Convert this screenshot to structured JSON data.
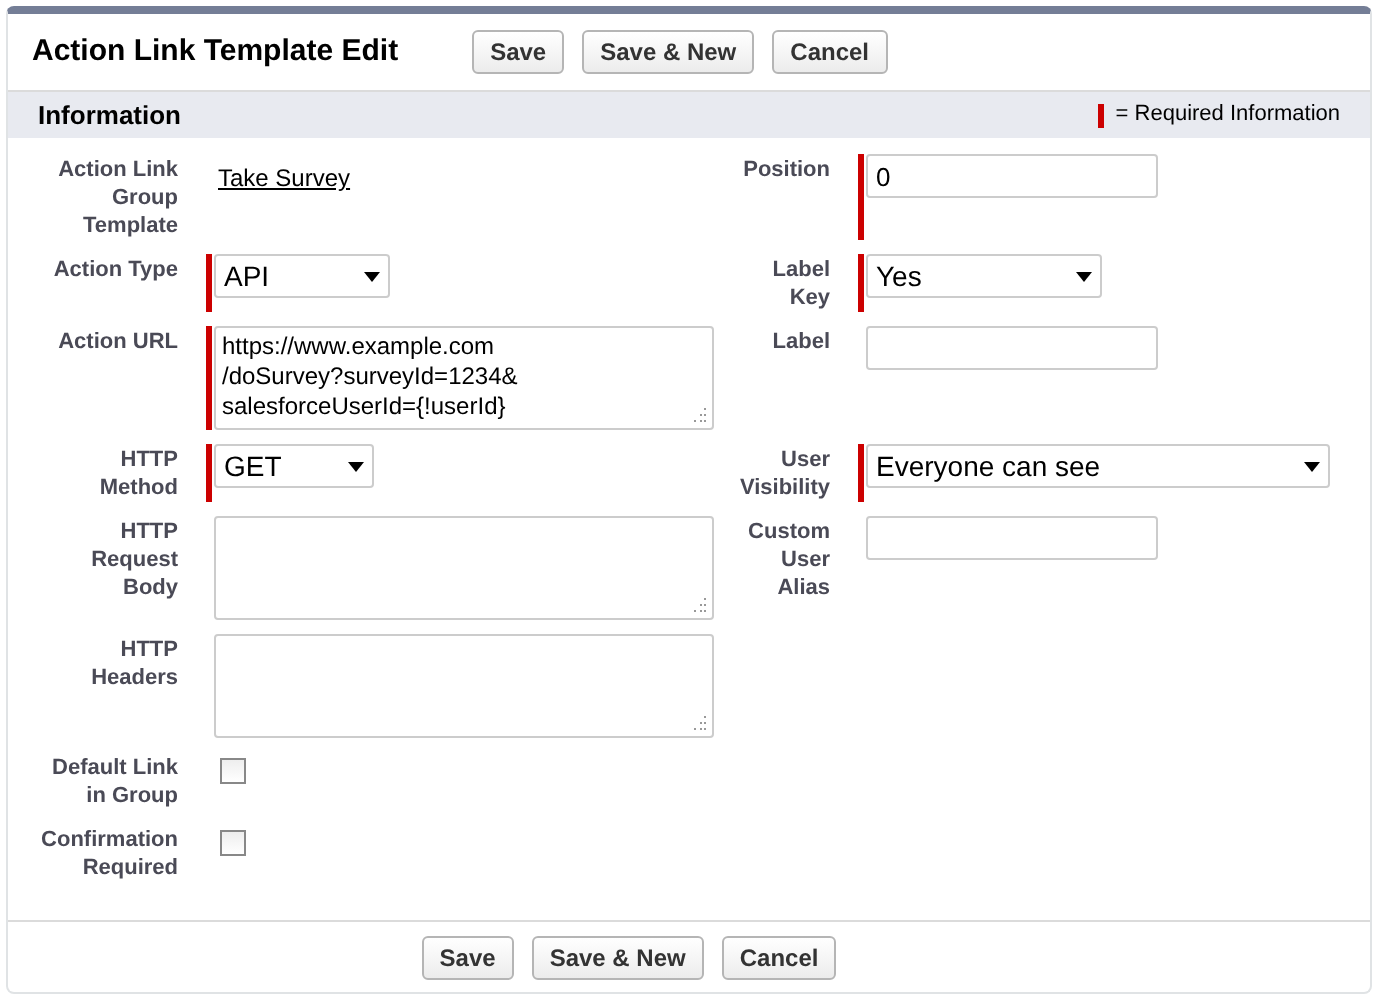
{
  "title": "Action Link Template Edit",
  "top_buttons": [
    "Save",
    "Save & New",
    "Cancel"
  ],
  "section": {
    "title": "Information",
    "legend": "= Required Information"
  },
  "rows": [
    [
      {
        "label": "Action Link Group Template",
        "kind": "link",
        "required": false,
        "value": "Take Survey"
      },
      {
        "label": "Position",
        "kind": "text",
        "required": true,
        "value": "0"
      }
    ],
    [
      {
        "label": "Action Type",
        "kind": "select",
        "required": true,
        "value": "API"
      },
      {
        "label": "Label Key",
        "kind": "select",
        "required": true,
        "value": "Yes"
      }
    ],
    [
      {
        "label": "Action URL",
        "kind": "textarea",
        "required": true,
        "value": "https://www.example.com\n/doSurvey?surveyId=1234&\nsalesforceUserId={!userId}"
      },
      {
        "label": "Label",
        "kind": "text",
        "required": false
      }
    ],
    [
      {
        "label": "HTTP Method",
        "kind": "select",
        "required": true,
        "value": "GET"
      },
      {
        "label": "User Visibility",
        "kind": "select",
        "required": true,
        "value": "Everyone can see"
      }
    ],
    [
      {
        "label": "HTTP Request Body",
        "kind": "textarea",
        "required": false
      },
      {
        "label": "Custom User Alias",
        "kind": "text",
        "required": false
      }
    ],
    [
      {
        "label": "HTTP Headers",
        "kind": "textarea",
        "required": false
      }
    ],
    [
      {
        "label": "Default Link in Group",
        "kind": "checkbox",
        "required": false,
        "checked": false
      }
    ],
    [
      {
        "label": "Confirmation Required",
        "kind": "checkbox",
        "required": false,
        "checked": false
      }
    ]
  ],
  "bottom_buttons": [
    "Save",
    "Save & New",
    "Cancel"
  ]
}
